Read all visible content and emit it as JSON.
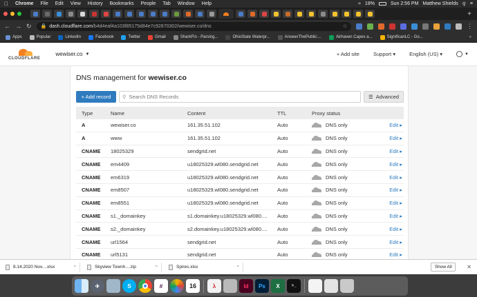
{
  "menubar": {
    "app": "Chrome",
    "items": [
      "File",
      "Edit",
      "View",
      "History",
      "Bookmarks",
      "People",
      "Tab",
      "Window",
      "Help"
    ],
    "battery": "18%",
    "clock": "Sun 2:56 PM",
    "user": "Matthew Shields"
  },
  "addressbar": {
    "host": "dash.cloudflare.com",
    "path": "/b4d4eaf4a103f85175d84e7c92870302/wewiser.co/dns"
  },
  "bookmarks": [
    "Apps",
    "Popular",
    "LinkedIn",
    "Facebook",
    "Twitter",
    "Gmail",
    "SharkFin - Parsing...",
    "OhioState Waterpr...",
    "AnswerThePublic:...",
    "Airhaven Capex a...",
    "SignificanLC - Go..."
  ],
  "bookmark_more": "»",
  "header": {
    "logo_text": "CLOUDFLARE",
    "account": "wewiser.co",
    "add_site": "+ Add site",
    "support": "Support ▾",
    "language": "English (US) ▾"
  },
  "panel": {
    "title_prefix": "DNS management for ",
    "title_domain": "wewiser.co",
    "add_record": "+ Add record",
    "search_placeholder": "Search DNS Records",
    "advanced": "Advanced"
  },
  "table": {
    "headers": [
      "Type",
      "Name",
      "Content",
      "TTL",
      "Proxy status",
      ""
    ],
    "rows": [
      {
        "type": "A",
        "name": "wewiser.co",
        "content": "161.35.51.102",
        "ttl": "Auto",
        "proxy": "DNS only",
        "edit": "Edit ▸"
      },
      {
        "type": "A",
        "name": "www",
        "content": "161.35.51.102",
        "ttl": "Auto",
        "proxy": "DNS only",
        "edit": "Edit ▸"
      },
      {
        "type": "CNAME",
        "name": "18025329",
        "content": "sendgrid.net",
        "ttl": "Auto",
        "proxy": "DNS only",
        "edit": "Edit ▸"
      },
      {
        "type": "CNAME",
        "name": "em4409",
        "content": "u18025329.wl080.sendgrid.net",
        "ttl": "Auto",
        "proxy": "DNS only",
        "edit": "Edit ▸"
      },
      {
        "type": "CNAME",
        "name": "em6319",
        "content": "u18025329.wl080.sendgrid.net",
        "ttl": "Auto",
        "proxy": "DNS only",
        "edit": "Edit ▸"
      },
      {
        "type": "CNAME",
        "name": "em8507",
        "content": "u18025329.wl080.sendgrid.net",
        "ttl": "Auto",
        "proxy": "DNS only",
        "edit": "Edit ▸"
      },
      {
        "type": "CNAME",
        "name": "em8551",
        "content": "u18025329.wl080.sendgrid.net",
        "ttl": "Auto",
        "proxy": "DNS only",
        "edit": "Edit ▸"
      },
      {
        "type": "CNAME",
        "name": "s1._domainkey",
        "content": "s1.domainkey.u18025329.wl080....",
        "ttl": "Auto",
        "proxy": "DNS only",
        "edit": "Edit ▸"
      },
      {
        "type": "CNAME",
        "name": "s2._domainkey",
        "content": "s2.domainkey.u18025329.wl080....",
        "ttl": "Auto",
        "proxy": "DNS only",
        "edit": "Edit ▸"
      },
      {
        "type": "CNAME",
        "name": "url1564",
        "content": "sendgrid.net",
        "ttl": "Auto",
        "proxy": "DNS only",
        "edit": "Edit ▸"
      },
      {
        "type": "CNAME",
        "name": "url5131",
        "content": "sendgrid.net",
        "ttl": "Auto",
        "proxy": "DNS only",
        "edit": "Edit ▸"
      }
    ]
  },
  "downloads": {
    "items": [
      "8.14.2020 Nov....xlsx",
      "Skyview Townh....zip",
      "Spires.xlsx"
    ],
    "show_all": "Show All"
  },
  "dock": {
    "calendar_day": "16",
    "icons": [
      "finder-icon",
      "launchpad-icon",
      "preview-icon",
      "skype-icon",
      "chrome-icon",
      "slack-icon",
      "photos-icon",
      "calendar-icon",
      "acrobat-icon",
      "calculator-icon",
      "indesign-icon",
      "photoshop-icon",
      "excel-icon",
      "terminal-icon",
      "document-icon",
      "notes-icon",
      "trash-icon"
    ]
  },
  "colors": {
    "accent_blue": "#2f7bbf",
    "cloudflare_orange": "#f38020",
    "proxy_grey": "#a8a8a8"
  }
}
